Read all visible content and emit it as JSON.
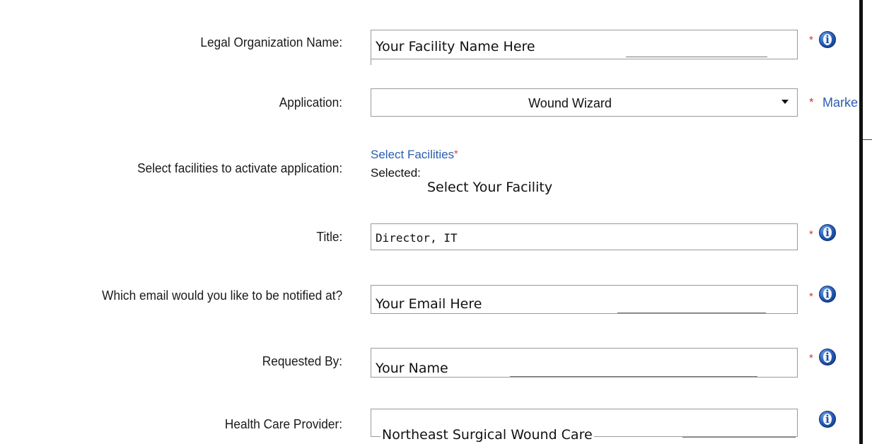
{
  "form": {
    "org_name": {
      "label": "Legal Organization Name:",
      "value": "Your Facility Name Here"
    },
    "application": {
      "label": "Application:",
      "value": "Wound Wizard",
      "side_link": "Marke"
    },
    "facilities": {
      "label": "Select facilities to activate application:",
      "link": "Select Facilities",
      "selected_label": "Selected:",
      "selected_value": "Select Your Facility"
    },
    "title": {
      "label": "Title:",
      "value": "Director, IT"
    },
    "email": {
      "label": "Which email would you like to be notified at?",
      "value": "Your Email Here"
    },
    "requested_by": {
      "label": "Requested By:",
      "value": "Your Name"
    },
    "provider": {
      "label": "Health Care Provider:",
      "value": "Northeast Surgical Wound Care"
    },
    "required_mark": "*",
    "info_glyph": "i"
  },
  "icons": {
    "info": "info-circle-icon",
    "dropdown": "caret-down-icon"
  },
  "colors": {
    "link": "#2a5db0",
    "required": "#e03030",
    "border": "#9a9a9a"
  }
}
